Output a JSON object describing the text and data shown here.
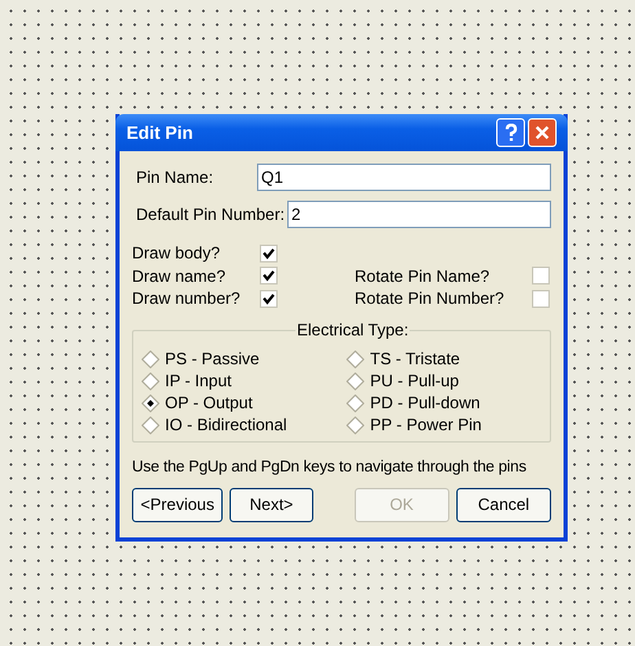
{
  "window": {
    "title": "Edit Pin"
  },
  "fields": [
    {
      "label": "Pin Name:",
      "value": "Q1"
    },
    {
      "label": "Default Pin Number:",
      "value": "2"
    }
  ],
  "checkboxes_left": [
    {
      "label": "Draw body?",
      "checked": true
    },
    {
      "label": "Draw name?",
      "checked": true
    },
    {
      "label": "Draw number?",
      "checked": true
    }
  ],
  "checkboxes_right": [
    {
      "label": "Rotate Pin Name?",
      "checked": false
    },
    {
      "label": "Rotate Pin Number?",
      "checked": false
    }
  ],
  "electrical_type": {
    "label": "Electrical Type:",
    "options": [
      {
        "label": "PS - Passive",
        "selected": false
      },
      {
        "label": "IP - Input",
        "selected": false
      },
      {
        "label": "OP - Output",
        "selected": true
      },
      {
        "label": "IO - Bidirectional",
        "selected": false
      },
      {
        "label": "TS - Tristate",
        "selected": false
      },
      {
        "label": "PU - Pull-up",
        "selected": false
      },
      {
        "label": "PD - Pull-down",
        "selected": false
      },
      {
        "label": "PP - Power Pin",
        "selected": false
      }
    ]
  },
  "hint": "Use the PgUp and PgDn keys to navigate through the pins",
  "buttons": [
    {
      "label": "<Previous",
      "disabled": false
    },
    {
      "label": "Next>",
      "disabled": false
    },
    {
      "label": "OK",
      "disabled": true
    },
    {
      "label": "Cancel",
      "disabled": false
    }
  ]
}
